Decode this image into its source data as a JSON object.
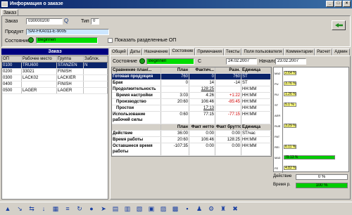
{
  "window": {
    "title": "Информация о заказе"
  },
  "tabs": {
    "main": "Заказ"
  },
  "header": {
    "order_label": "Заказ",
    "order_value": "030000200",
    "type_label": "Тип",
    "type_value": "0",
    "product_label": "Продукт",
    "product_value": "SAI-FKA011-E-9005",
    "status_label": "Состояние",
    "status_value": "Beginnen",
    "show_split_label": "Показать разделенные ОП"
  },
  "left": {
    "title": "Заказ",
    "columns": [
      "ОП",
      "Рабочее место",
      "Группа",
      "Заблок."
    ],
    "rows": [
      [
        "0100",
        "TRU600",
        "STANZEN",
        "N"
      ],
      [
        "0200",
        "33021",
        "FINISH",
        ""
      ],
      [
        "0300",
        "LACK02",
        "LACKIER",
        ""
      ],
      [
        "0400",
        "",
        "FINISH",
        ""
      ],
      [
        "0500",
        "LAGER",
        "LAGER",
        ""
      ]
    ]
  },
  "right_tabs": [
    "Общий",
    "Даты",
    "Назначение",
    "Состояние",
    "Примечания",
    "Тексты",
    "Поля пользователя",
    "Комментарии",
    "Расчет",
    "Админ"
  ],
  "state": {
    "label": "Состояние",
    "value": "Beginnen",
    "code": "C",
    "date_end": "24.02.2007",
    "start_label": "Начало",
    "date_start": "23.02.2007"
  },
  "grid1": {
    "headers": [
      "Сравнение план/...",
      "План",
      "Фактич...",
      "Разн.",
      "Единица"
    ],
    "rows": [
      [
        "Готовая продукция",
        "760",
        "0",
        "760",
        "ST"
      ],
      [
        "Брак",
        "0",
        "14",
        "-14",
        "ST"
      ],
      [
        "Продолжительность",
        "",
        "128:25",
        "",
        "HH:MM"
      ],
      [
        "Время настройки",
        "3:03",
        "4:26",
        "+1:22",
        "HH:MM"
      ],
      [
        "Производство",
        "20:60",
        "106:46",
        "-85:45",
        "HH:MM"
      ],
      [
        "Простои",
        "",
        "17:13",
        "",
        "HH:MM"
      ],
      [
        "Использование рабочей силы",
        "0:60",
        "77:15",
        "-77:15",
        "HH:MM"
      ]
    ]
  },
  "grid2": {
    "headers": [
      "",
      "План",
      "Факт нетто",
      "Факт брутто",
      "Единица"
    ],
    "rows": [
      [
        "Действие",
        "36:00",
        "0:00",
        "0:00",
        "ST/час"
      ],
      [
        "Время работы",
        "20:60",
        "106:46",
        "128:25",
        "HH:MM"
      ],
      [
        "Оставшееся время работы",
        "-107:35",
        "0:00",
        "0:00",
        "HH:MM"
      ]
    ]
  },
  "chart_data": {
    "type": "bar",
    "categories": [
      "MA2",
      "PU",
      "RU",
      "ST",
      "AER",
      "RUE",
      "PAT",
      "REI",
      "MA3",
      "FE"
    ],
    "values": [
      2.64,
      3.76,
      1.26,
      5.1,
      0,
      3.29,
      0,
      6.11,
      79.13,
      4.82
    ],
    "labels": [
      "2.64 %",
      "3.76 %",
      "1.26 %",
      "5.1 %",
      "",
      "3.29 %",
      "",
      "6.11 %",
      "79.13 %",
      "4.82 %"
    ]
  },
  "progress": {
    "action_label": "Действие",
    "action_value": "0 %",
    "action_fraction": 0,
    "time_label": "Время р.",
    "time_value": "100 %",
    "time_fraction": 1
  }
}
